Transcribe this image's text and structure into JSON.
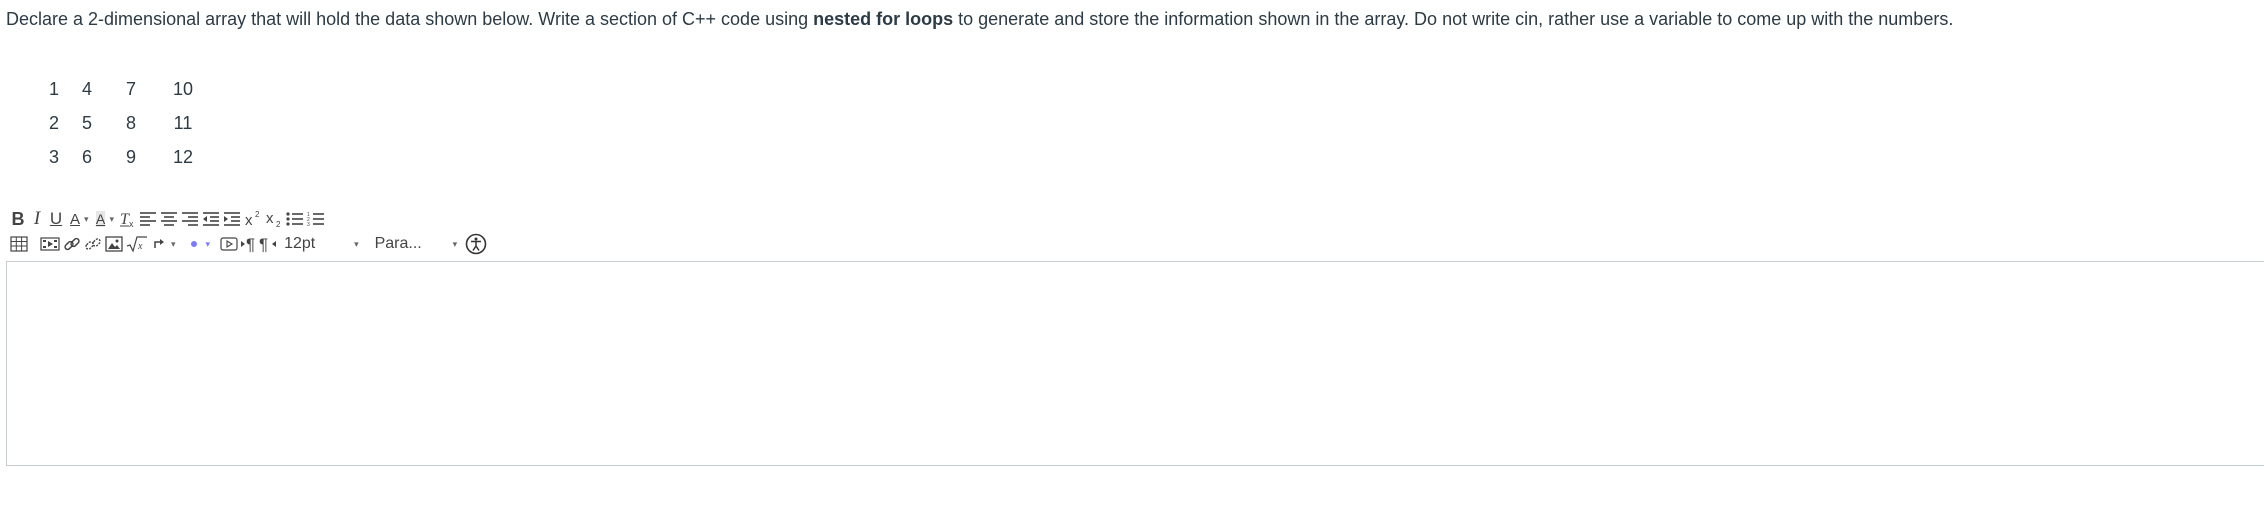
{
  "question": {
    "text_before": "Declare a 2-dimensional array that will hold the data shown below.  Write a section of C++ code using ",
    "text_bold": "nested for loops",
    "text_after": " to generate and store the information shown in the array.  Do not write cin, rather use a variable to come up with the numbers."
  },
  "array_table": {
    "rows": [
      [
        "1",
        "4",
        "7",
        "10"
      ],
      [
        "2",
        "5",
        "8",
        "11"
      ],
      [
        "3",
        "6",
        "9",
        "12"
      ]
    ]
  },
  "toolbar": {
    "bold_label": "B",
    "italic_label": "I",
    "underline_label": "U",
    "text_color_label": "A",
    "background_color_label": "A",
    "font_size_value": "12pt",
    "paragraph_value": "Para..."
  },
  "icons": {
    "row1": [
      "bold-icon",
      "italic-icon",
      "underline-icon",
      "text-color-icon",
      "background-color-icon",
      "clear-formatting-icon",
      "align-left-icon",
      "align-center-icon",
      "align-right-icon",
      "indent-icon",
      "outdent-icon",
      "superscript-icon",
      "subscript-icon",
      "bullet-list-icon",
      "numbered-list-icon"
    ],
    "row2": [
      "table-icon",
      "media-icon",
      "link-icon",
      "unlink-icon",
      "image-icon",
      "equation-icon",
      "lti-tool-icon",
      "record-media-icon",
      "ltr-icon",
      "rtl-icon",
      "accessibility-checker-icon"
    ]
  },
  "colors": {
    "text": "#2d3b45",
    "toolbar_icon": "#444444",
    "editor_border": "#c7cdd1"
  }
}
